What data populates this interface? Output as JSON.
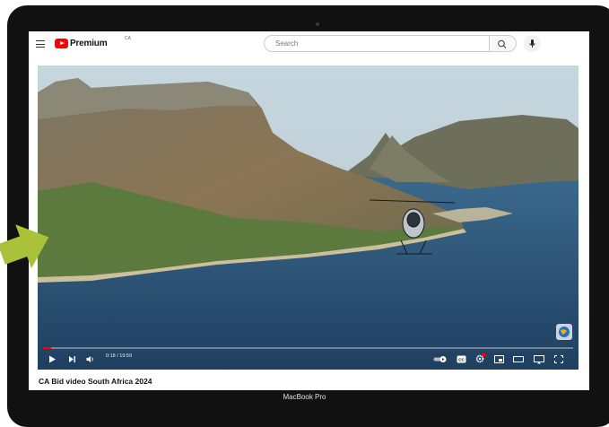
{
  "device": {
    "label": "MacBook Pro"
  },
  "masthead": {
    "brand": "Premium",
    "country": "CA",
    "search_placeholder": "Search"
  },
  "video": {
    "title": "CA Bid video South Africa 2024",
    "time": "0:18 / 19:59",
    "progress": 0.015
  },
  "colors": {
    "accent": "#ff0000",
    "arrow": "#a9c23a"
  },
  "icons": [
    "menu-icon",
    "youtube-logo-icon",
    "search-icon",
    "microphone-icon",
    "play-icon",
    "next-icon",
    "volume-icon",
    "autoplay-toggle-icon",
    "subtitles-icon",
    "settings-icon",
    "miniplayer-icon",
    "theater-mode-icon",
    "cast-icon",
    "fullscreen-icon"
  ]
}
